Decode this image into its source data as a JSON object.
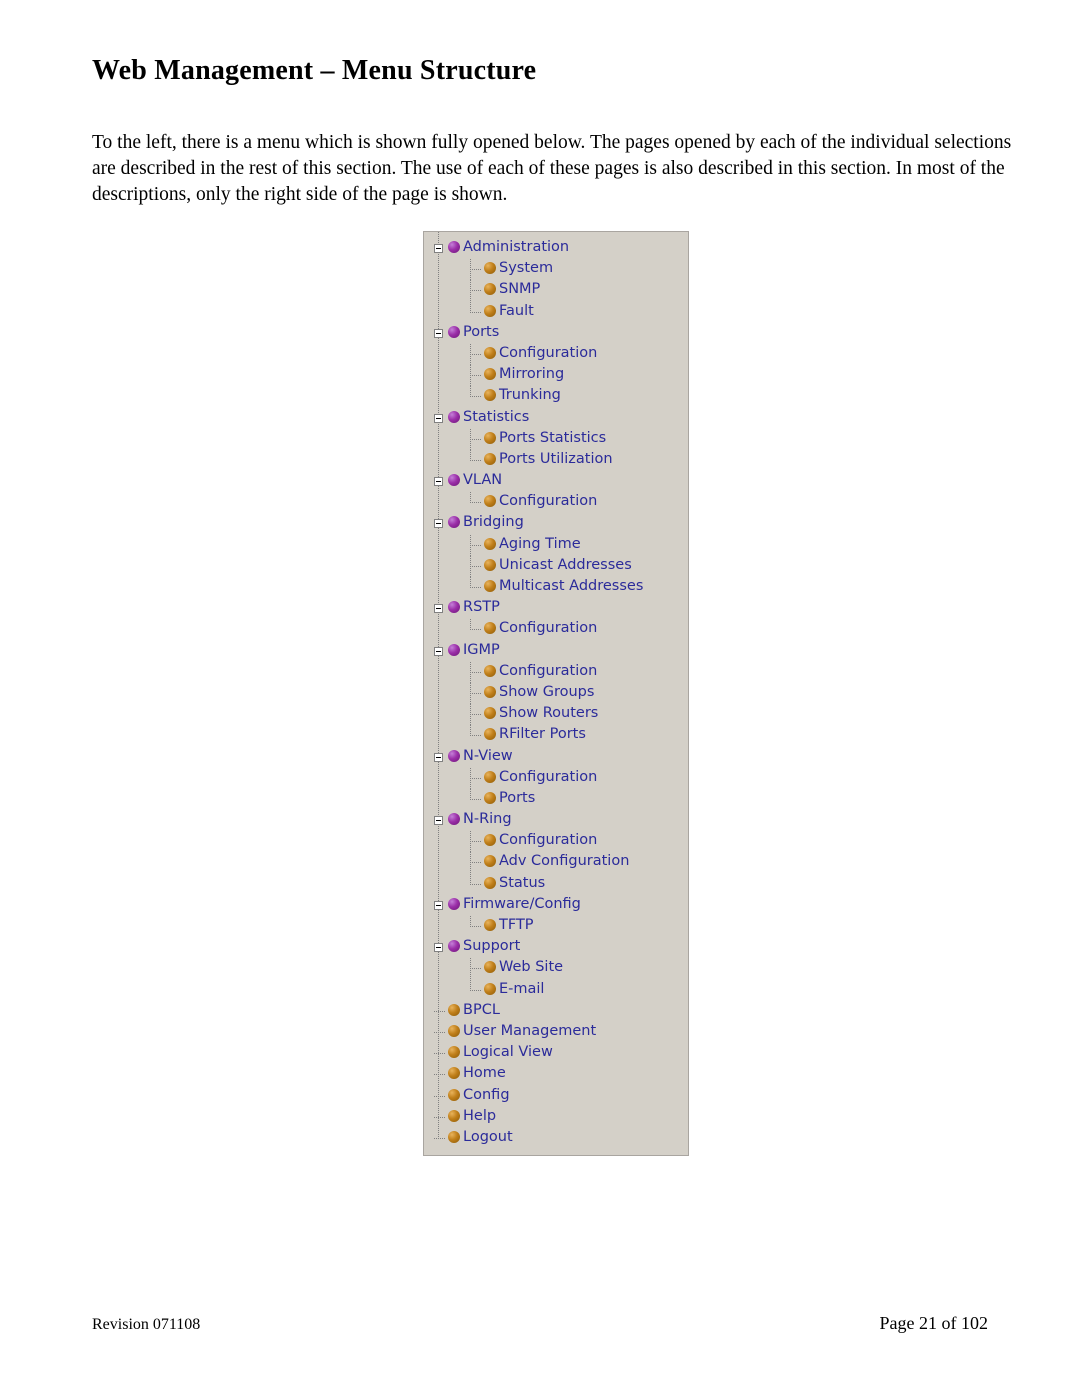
{
  "page": {
    "title": "Web Management – Menu Structure",
    "intro": "To the left, there is a menu which is shown fully opened below.  The pages opened by each of the individual selections are described in the rest of this section.  The use of each of these pages is also described in this section.  In most of the descriptions, only the right side of the page is shown.",
    "footer_left": "Revision 071108",
    "footer_right": "Page 21 of 102"
  },
  "colors": {
    "panel_background": "#d4d0c8",
    "link_text": "#2b2b9a",
    "parent_bullet": "#9b2fa8",
    "child_bullet": "#c07f1a"
  },
  "menu": {
    "nodes": [
      {
        "label": "Administration",
        "level": 0,
        "expandable": true,
        "bullet": "purple"
      },
      {
        "label": "System",
        "level": 1,
        "expandable": false,
        "bullet": "gold"
      },
      {
        "label": "SNMP",
        "level": 1,
        "expandable": false,
        "bullet": "gold"
      },
      {
        "label": "Fault",
        "level": 1,
        "expandable": false,
        "bullet": "gold",
        "last": true
      },
      {
        "label": "Ports",
        "level": 0,
        "expandable": true,
        "bullet": "purple"
      },
      {
        "label": "Configuration",
        "level": 1,
        "expandable": false,
        "bullet": "gold"
      },
      {
        "label": "Mirroring",
        "level": 1,
        "expandable": false,
        "bullet": "gold"
      },
      {
        "label": "Trunking",
        "level": 1,
        "expandable": false,
        "bullet": "gold",
        "last": true
      },
      {
        "label": "Statistics",
        "level": 0,
        "expandable": true,
        "bullet": "purple"
      },
      {
        "label": "Ports Statistics",
        "level": 1,
        "expandable": false,
        "bullet": "gold"
      },
      {
        "label": "Ports Utilization",
        "level": 1,
        "expandable": false,
        "bullet": "gold",
        "last": true
      },
      {
        "label": "VLAN",
        "level": 0,
        "expandable": true,
        "bullet": "purple"
      },
      {
        "label": "Configuration",
        "level": 1,
        "expandable": false,
        "bullet": "gold",
        "last": true
      },
      {
        "label": "Bridging",
        "level": 0,
        "expandable": true,
        "bullet": "purple"
      },
      {
        "label": "Aging Time",
        "level": 1,
        "expandable": false,
        "bullet": "gold"
      },
      {
        "label": "Unicast Addresses",
        "level": 1,
        "expandable": false,
        "bullet": "gold"
      },
      {
        "label": "Multicast Addresses",
        "level": 1,
        "expandable": false,
        "bullet": "gold",
        "last": true
      },
      {
        "label": "RSTP",
        "level": 0,
        "expandable": true,
        "bullet": "purple"
      },
      {
        "label": "Configuration",
        "level": 1,
        "expandable": false,
        "bullet": "gold",
        "last": true
      },
      {
        "label": "IGMP",
        "level": 0,
        "expandable": true,
        "bullet": "purple"
      },
      {
        "label": "Configuration",
        "level": 1,
        "expandable": false,
        "bullet": "gold"
      },
      {
        "label": "Show Groups",
        "level": 1,
        "expandable": false,
        "bullet": "gold"
      },
      {
        "label": "Show Routers",
        "level": 1,
        "expandable": false,
        "bullet": "gold"
      },
      {
        "label": "RFilter Ports",
        "level": 1,
        "expandable": false,
        "bullet": "gold",
        "last": true
      },
      {
        "label": "N-View",
        "level": 0,
        "expandable": true,
        "bullet": "purple"
      },
      {
        "label": "Configuration",
        "level": 1,
        "expandable": false,
        "bullet": "gold"
      },
      {
        "label": "Ports",
        "level": 1,
        "expandable": false,
        "bullet": "gold",
        "last": true
      },
      {
        "label": "N-Ring",
        "level": 0,
        "expandable": true,
        "bullet": "purple"
      },
      {
        "label": "Configuration",
        "level": 1,
        "expandable": false,
        "bullet": "gold"
      },
      {
        "label": "Adv Configuration",
        "level": 1,
        "expandable": false,
        "bullet": "gold"
      },
      {
        "label": "Status",
        "level": 1,
        "expandable": false,
        "bullet": "gold",
        "last": true
      },
      {
        "label": "Firmware/Config",
        "level": 0,
        "expandable": true,
        "bullet": "purple"
      },
      {
        "label": "TFTP",
        "level": 1,
        "expandable": false,
        "bullet": "gold",
        "last": true
      },
      {
        "label": "Support",
        "level": 0,
        "expandable": true,
        "bullet": "purple"
      },
      {
        "label": "Web Site",
        "level": 1,
        "expandable": false,
        "bullet": "gold"
      },
      {
        "label": "E-mail",
        "level": 1,
        "expandable": false,
        "bullet": "gold",
        "last": true
      },
      {
        "label": "BPCL",
        "level": 0,
        "expandable": false,
        "bullet": "gold"
      },
      {
        "label": "User Management",
        "level": 0,
        "expandable": false,
        "bullet": "gold"
      },
      {
        "label": "Logical View",
        "level": 0,
        "expandable": false,
        "bullet": "gold"
      },
      {
        "label": "Home",
        "level": 0,
        "expandable": false,
        "bullet": "gold"
      },
      {
        "label": "Config",
        "level": 0,
        "expandable": false,
        "bullet": "gold"
      },
      {
        "label": "Help",
        "level": 0,
        "expandable": false,
        "bullet": "gold"
      },
      {
        "label": "Logout",
        "level": 0,
        "expandable": false,
        "bullet": "gold",
        "last": true
      }
    ]
  }
}
